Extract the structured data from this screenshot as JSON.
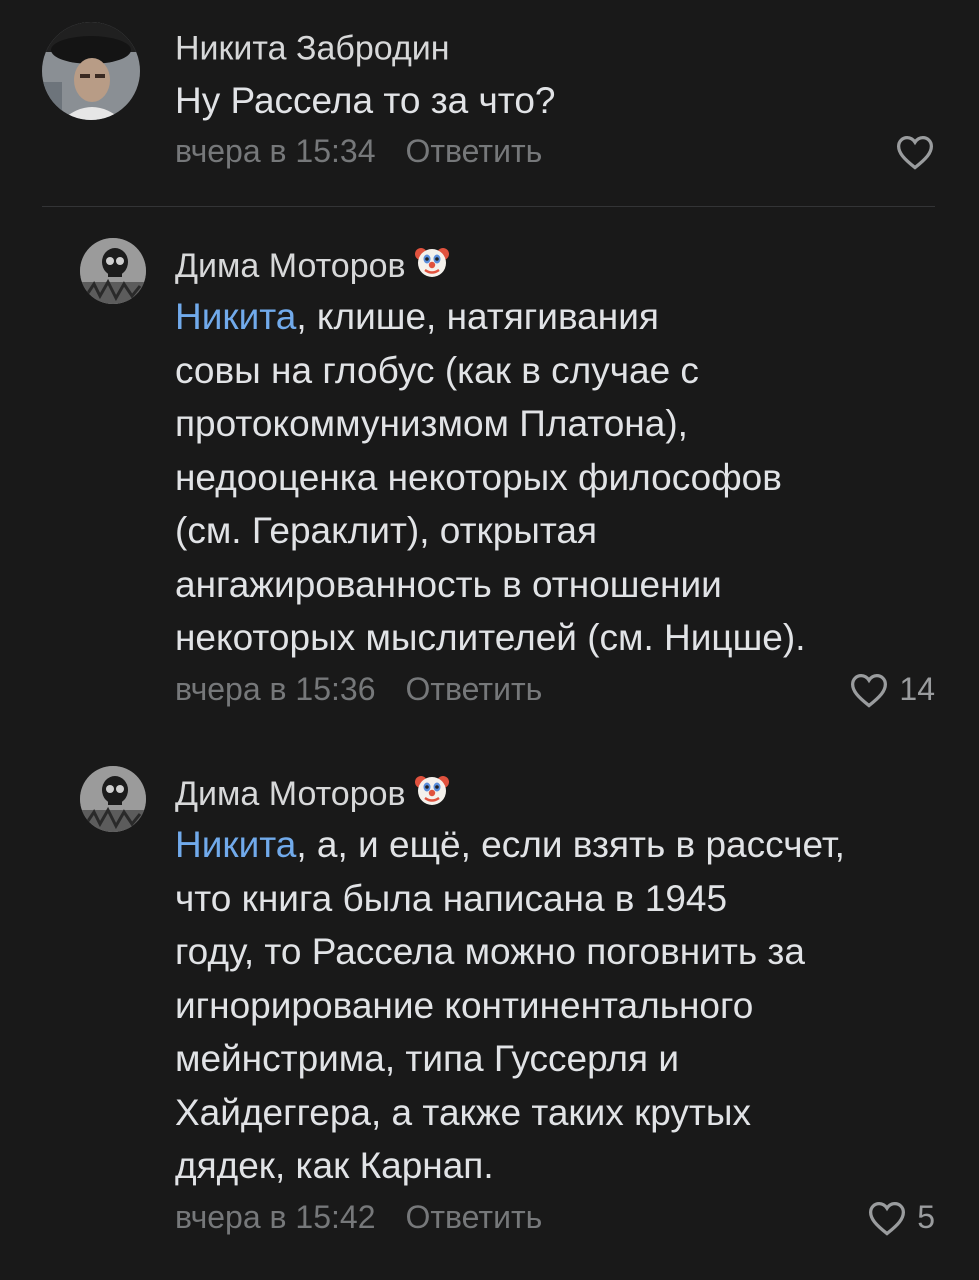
{
  "comments": [
    {
      "author": "Никита Забродин",
      "has_badge": false,
      "mention": "",
      "lines": [
        "Ну Рассела то за что?"
      ],
      "time": "вчера в 15:34",
      "reply_label": "Ответить",
      "likes": ""
    },
    {
      "author": "Дима Моторов",
      "has_badge": true,
      "badge_icon": "clown-face-emoji",
      "mention": "Никита",
      "lines": [
        ", клише, натягивания",
        "совы на глобус (как в случае с",
        "протокоммунизмом Платона),",
        "недооценка некоторых философов",
        "(см. Гераклит), открытая",
        "ангажированность в отношении",
        "некоторых мыслителей (см. Ницше)."
      ],
      "time": "вчера в 15:36",
      "reply_label": "Ответить",
      "likes": "14"
    },
    {
      "author": "Дима Моторов",
      "has_badge": true,
      "badge_icon": "clown-face-emoji",
      "mention": "Никита",
      "lines": [
        ", а, и ещё, если взять в рассчет,",
        "что книга была написана в 1945",
        "году, то Рассела можно поговнить за",
        "игнорирование континентального",
        "мейнстрима, типа Гуссерля и",
        "Хайдеггера, а также таких крутых",
        "дядек, как Карнап."
      ],
      "time": "вчера в 15:42",
      "reply_label": "Ответить",
      "likes": "5"
    }
  ],
  "colors": {
    "background": "#191919",
    "text": "#e1e3e6",
    "mention": "#71aaeb",
    "secondary": "#76787a"
  }
}
